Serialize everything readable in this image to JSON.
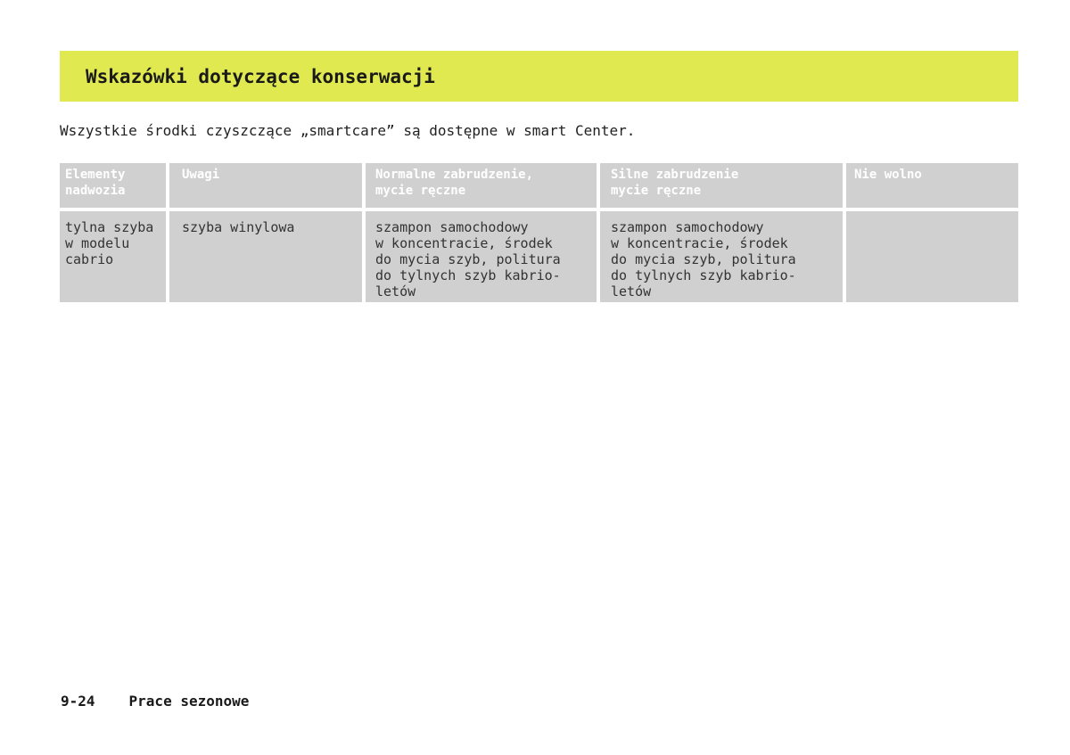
{
  "header": {
    "title": "Wskazówki dotyczące konserwacji"
  },
  "intro": "Wszystkie środki czyszczące „smartcare” są dostępne w smart Center.",
  "table": {
    "headers": [
      "Elementy\nnadwozia",
      "Uwagi",
      "Normalne zabrudzenie,\nmycie ręczne",
      "Silne zabrudzenie\nmycie ręczne",
      "Nie wolno"
    ],
    "rows": [
      [
        "tylna szyba\nw modelu\ncabrio",
        "szyba winylowa",
        "szampon samochodowy\nw koncentracie, środek\ndo mycia szyb, politura\ndo tylnych szyb kabrio-\nletów",
        "szampon samochodowy\nw koncentracie, środek\ndo mycia szyb, politura\ndo tylnych szyb kabrio-\nletów",
        ""
      ]
    ]
  },
  "footer": {
    "page_number": "9-24",
    "section": "Prace sezonowe"
  },
  "colors": {
    "title_bar": "#e0ea50",
    "table_cell": "#d0d0d0",
    "header_text": "#ffffff"
  }
}
